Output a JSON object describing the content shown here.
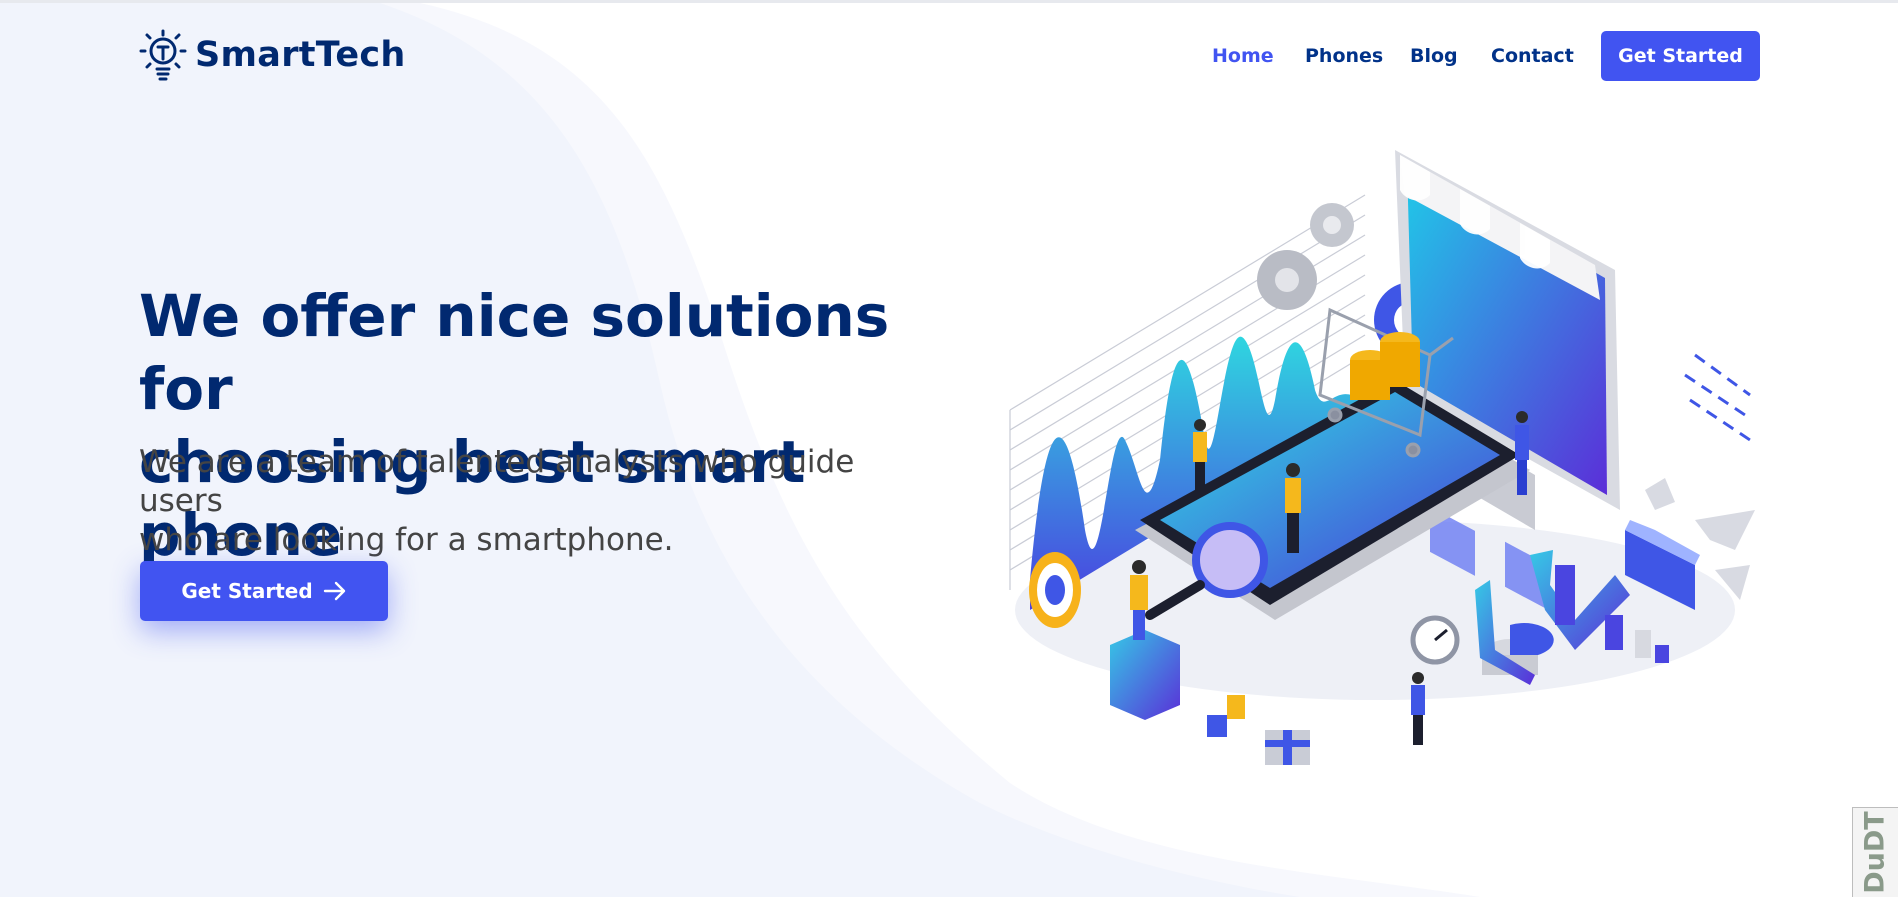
{
  "brand": {
    "name": "SmartTech",
    "icon": "lightbulb-gear-icon"
  },
  "nav": {
    "items": [
      {
        "label": "Home",
        "active": true
      },
      {
        "label": "Phones",
        "active": false
      },
      {
        "label": "Blog",
        "active": false
      },
      {
        "label": "Contact",
        "active": false
      }
    ],
    "cta_label": "Get Started"
  },
  "hero": {
    "title_line1": "We offer nice solutions for",
    "title_line2": "choosing best smart phone",
    "subtitle_line1": "We are a team of talented analysts who guide users",
    "subtitle_line2": "who are looking for a smartphone.",
    "cta_label": "Get Started",
    "cta_icon": "arrow-right-icon"
  },
  "illustration": {
    "subject": "isometric-online-shop-illustration"
  },
  "badge": {
    "text": "DuDT"
  },
  "colors": {
    "primary": "#4154f1",
    "heading": "#012970",
    "nav_text": "#013289",
    "body_text": "#444444",
    "background_wave": "#f1f4fc"
  }
}
